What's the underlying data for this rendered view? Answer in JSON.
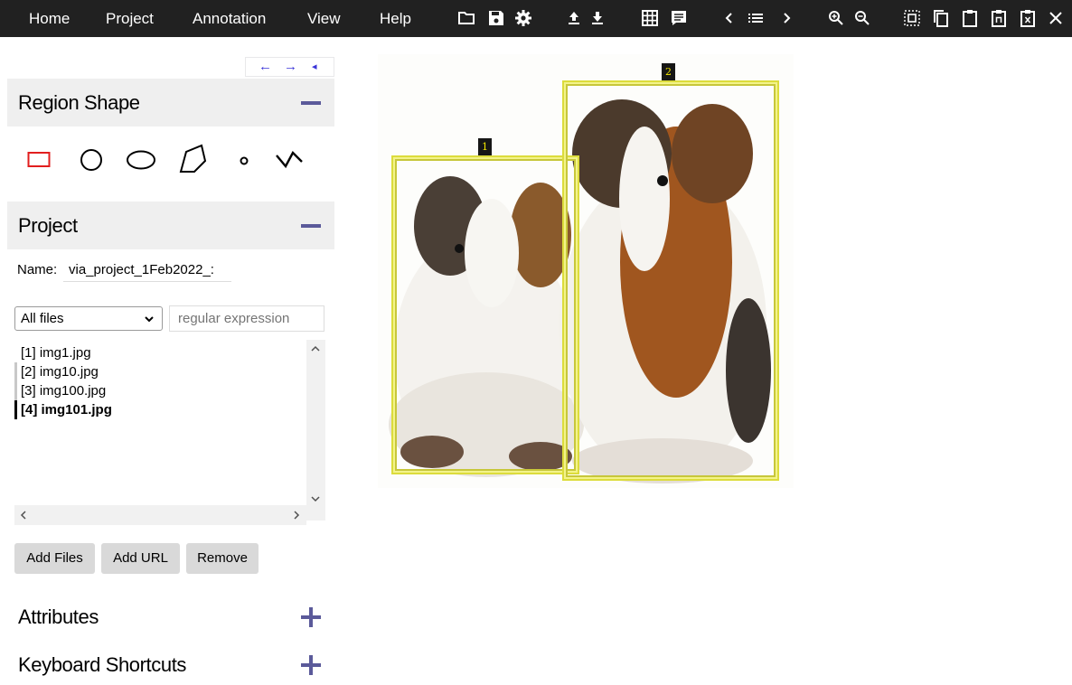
{
  "menu": {
    "items": [
      {
        "label": "Home"
      },
      {
        "label": "Project"
      },
      {
        "label": "Annotation"
      },
      {
        "label": "View"
      },
      {
        "label": "Help"
      }
    ]
  },
  "toolbar": {
    "icons": [
      "folder-icon",
      "save-icon",
      "gear-icon",
      "upload-icon",
      "download-icon",
      "grid-icon",
      "comment-icon",
      "chevron-left-icon",
      "list-icon",
      "chevron-right-icon",
      "zoom-in-icon",
      "zoom-out-icon",
      "select-all-icon",
      "copy-icon",
      "paste-icon",
      "paste-n-icon",
      "paste-x-icon",
      "close-icon"
    ]
  },
  "nav": {
    "left": "←",
    "right": "→",
    "collapse": "◂"
  },
  "region_shape": {
    "title": "Region Shape",
    "toggle": "minus",
    "shapes": [
      "rectangle-icon",
      "circle-icon",
      "ellipse-icon",
      "polygon-icon",
      "point-icon",
      "polyline-icon"
    ],
    "selected": "rectangle-icon",
    "selected_color": "#e21e1e"
  },
  "project": {
    "title": "Project",
    "toggle": "minus",
    "name_label": "Name:",
    "name_value": "via_project_1Feb2022_:",
    "filter_selected": "All files",
    "regex_placeholder": "regular expression",
    "files": [
      {
        "label": "[1] img1.jpg",
        "state": "normal"
      },
      {
        "label": "[2] img10.jpg",
        "state": "marked"
      },
      {
        "label": "[3] img100.jpg",
        "state": "marked"
      },
      {
        "label": "[4] img101.jpg",
        "state": "active"
      }
    ],
    "buttons": {
      "add_files": "Add Files",
      "add_url": "Add URL",
      "remove": "Remove"
    }
  },
  "attributes": {
    "title": "Attributes",
    "toggle": "plus"
  },
  "shortcuts": {
    "title": "Keyboard Shortcuts",
    "toggle": "plus"
  },
  "annotations": {
    "regions": [
      {
        "label": "1"
      },
      {
        "label": "2"
      }
    ],
    "box_color": "#dcdc3c",
    "label_bg": "#161616",
    "label_fg": "#f4e800"
  },
  "colors": {
    "topbar": "#212121",
    "accent": "#5b5a9a",
    "section_bg": "#efefef"
  }
}
